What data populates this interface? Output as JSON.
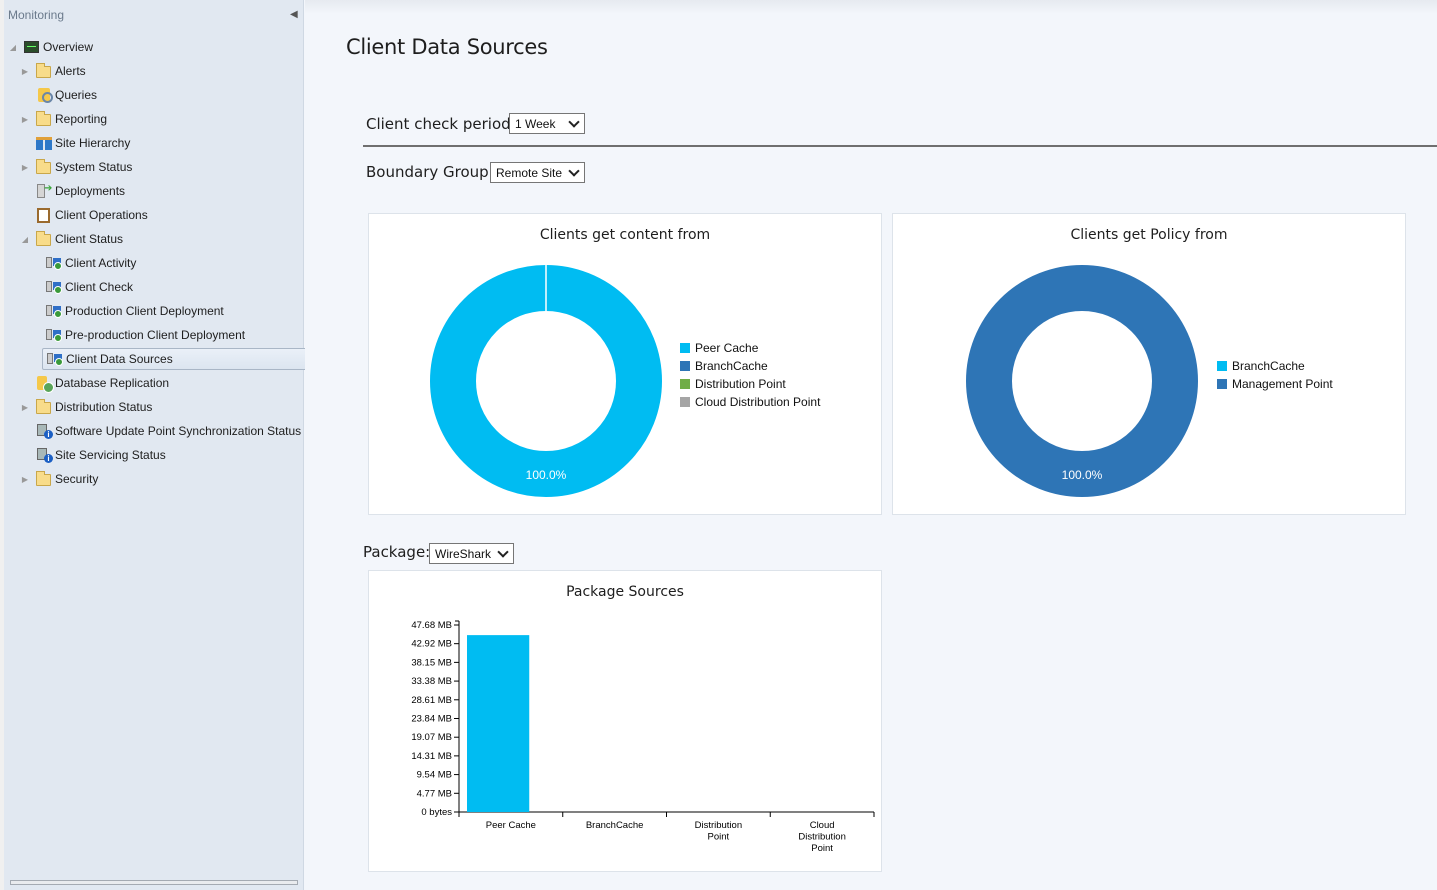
{
  "sidebar": {
    "header": "Monitoring",
    "collapse_icon": "chevron-left-icon",
    "items": [
      {
        "label": "Overview",
        "icon": "monitor-icon",
        "expander": "expanded",
        "level": 0
      },
      {
        "label": "Alerts",
        "icon": "folder-icon",
        "expander": "collapsed",
        "level": 1
      },
      {
        "label": "Queries",
        "icon": "query-icon",
        "expander": "none",
        "level": 1
      },
      {
        "label": "Reporting",
        "icon": "folder-icon",
        "expander": "collapsed",
        "level": 1
      },
      {
        "label": "Site Hierarchy",
        "icon": "site-hierarchy-icon",
        "expander": "none",
        "level": 1
      },
      {
        "label": "System Status",
        "icon": "folder-icon",
        "expander": "collapsed",
        "level": 1
      },
      {
        "label": "Deployments",
        "icon": "deployments-icon",
        "expander": "none",
        "level": 1
      },
      {
        "label": "Client Operations",
        "icon": "clipboard-icon",
        "expander": "none",
        "level": 1
      },
      {
        "label": "Client Status",
        "icon": "folder-icon",
        "expander": "expanded",
        "level": 1
      },
      {
        "label": "Client Activity",
        "icon": "client-status-icon",
        "expander": "none",
        "level": 2
      },
      {
        "label": "Client Check",
        "icon": "client-status-icon",
        "expander": "none",
        "level": 2
      },
      {
        "label": "Production Client Deployment",
        "icon": "client-status-icon",
        "expander": "none",
        "level": 2
      },
      {
        "label": "Pre-production Client Deployment",
        "icon": "client-status-icon",
        "expander": "none",
        "level": 2
      },
      {
        "label": "Client Data Sources",
        "icon": "client-status-icon",
        "expander": "none",
        "level": 2,
        "selected": true
      },
      {
        "label": "Database Replication",
        "icon": "database-replication-icon",
        "expander": "none",
        "level": 1
      },
      {
        "label": "Distribution Status",
        "icon": "folder-icon",
        "expander": "collapsed",
        "level": 1
      },
      {
        "label": "Software Update Point Synchronization Status",
        "icon": "sup-sync-icon",
        "expander": "none",
        "level": 1
      },
      {
        "label": "Site Servicing Status",
        "icon": "site-servicing-icon",
        "expander": "none",
        "level": 1
      },
      {
        "label": "Security",
        "icon": "folder-icon",
        "expander": "collapsed",
        "level": 1
      }
    ]
  },
  "main": {
    "title": "Client Data Sources",
    "client_check_period": {
      "label": "Client check period:",
      "value": "1 Week"
    },
    "boundary_group": {
      "label": "Boundary Group:",
      "value": "Remote Site"
    },
    "package": {
      "label": "Package:",
      "value": "WireShark"
    }
  },
  "colors": {
    "peer_cache": "#00bcf2",
    "branchcache": "#2e75b6",
    "distribution_point": "#70ad47",
    "cloud_distribution_point": "#a5a5a5",
    "policy_branchcache": "#00bcf2",
    "management_point": "#2e75b6"
  },
  "chart_data": [
    {
      "type": "pie",
      "title": "Clients get content from",
      "categories": [
        "Peer Cache",
        "BranchCache",
        "Distribution Point",
        "Cloud Distribution Point"
      ],
      "values": [
        100,
        0,
        0,
        0
      ],
      "colors": [
        "#00bcf2",
        "#2e75b6",
        "#70ad47",
        "#a5a5a5"
      ],
      "data_labels": [
        "100.0%"
      ],
      "donut": true,
      "legend": "right"
    },
    {
      "type": "pie",
      "title": "Clients get Policy from",
      "categories": [
        "BranchCache",
        "Management Point"
      ],
      "values": [
        0,
        100
      ],
      "colors": [
        "#00bcf2",
        "#2e75b6"
      ],
      "data_labels": [
        "100.0%"
      ],
      "donut": true,
      "legend": "right"
    },
    {
      "type": "bar",
      "title": "Package Sources",
      "categories": [
        "Peer Cache",
        "BranchCache",
        "Distribution Point",
        "Cloud Distribution Point"
      ],
      "category_lines": [
        [
          "Peer Cache"
        ],
        [
          "BranchCache"
        ],
        [
          "Distribution",
          "Point"
        ],
        [
          "Cloud",
          "Distribution",
          "Point"
        ]
      ],
      "values_mb": [
        45.1,
        0,
        0,
        0
      ],
      "color": "#00bcf2",
      "yticks": [
        "0 bytes",
        "4.77 MB",
        "9.54 MB",
        "14.31 MB",
        "19.07 MB",
        "23.84 MB",
        "28.61 MB",
        "33.38 MB",
        "38.15 MB",
        "42.92 MB",
        "47.68 MB"
      ],
      "ytick_values_mb": [
        0,
        4.77,
        9.54,
        14.31,
        19.07,
        23.84,
        28.61,
        33.38,
        38.15,
        42.92,
        47.68
      ],
      "ylim_mb": [
        0,
        47.68
      ],
      "xlabel": "",
      "ylabel": "",
      "grid": false
    }
  ]
}
